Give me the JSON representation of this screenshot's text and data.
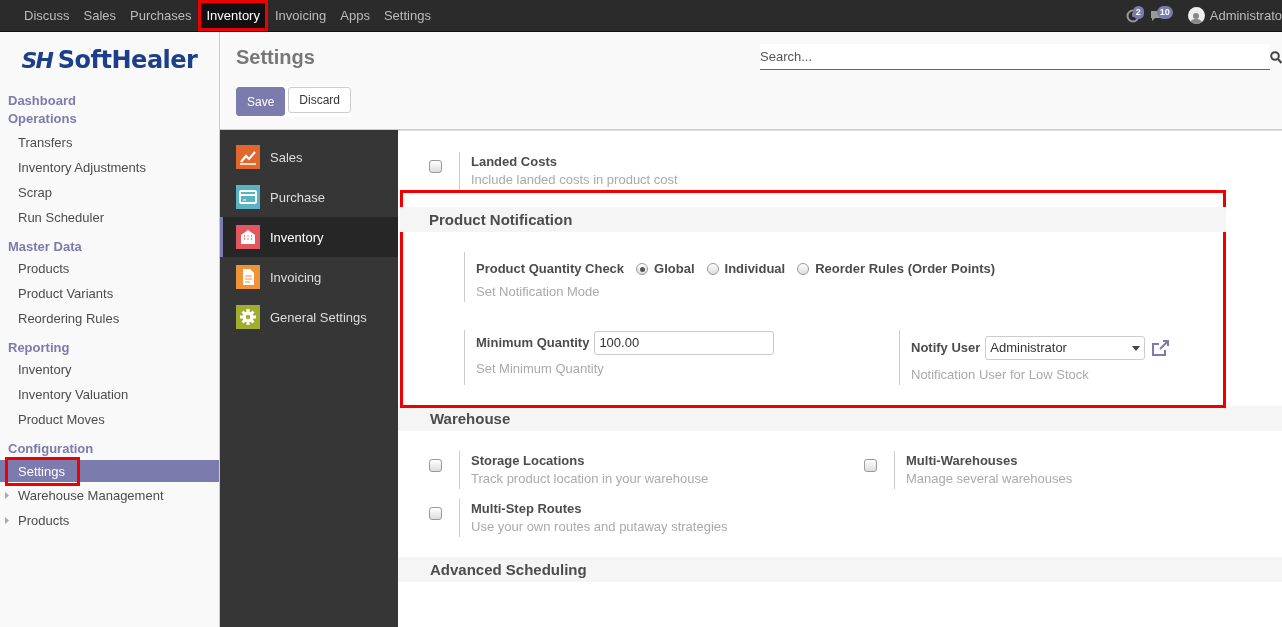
{
  "top_menu": [
    {
      "label": "Discuss",
      "selected": false,
      "highlighted": false
    },
    {
      "label": "Sales",
      "selected": false,
      "highlighted": false
    },
    {
      "label": "Purchases",
      "selected": false,
      "highlighted": false
    },
    {
      "label": "Inventory",
      "selected": true,
      "highlighted": true
    },
    {
      "label": "Invoicing",
      "selected": false,
      "highlighted": false
    },
    {
      "label": "Apps",
      "selected": false,
      "highlighted": false
    },
    {
      "label": "Settings",
      "selected": false,
      "highlighted": false
    }
  ],
  "systray": {
    "activity_count": "2",
    "message_count": "10",
    "user_name": "Administrato"
  },
  "logo": {
    "mark": "SH",
    "text": "SoftHealer"
  },
  "sidebar": {
    "sections": [
      {
        "title": "Dashboard"
      },
      {
        "title": "Operations",
        "items": [
          {
            "label": "Transfers",
            "kind": "link",
            "selected": false,
            "highlighted": false
          },
          {
            "label": "Inventory Adjustments",
            "kind": "link",
            "selected": false,
            "highlighted": false
          },
          {
            "label": "Scrap",
            "kind": "link",
            "selected": false,
            "highlighted": false
          },
          {
            "label": "Run Scheduler",
            "kind": "link",
            "selected": false,
            "highlighted": false
          }
        ]
      },
      {
        "title": "Master Data",
        "items": [
          {
            "label": "Products",
            "kind": "link",
            "selected": false,
            "highlighted": false
          },
          {
            "label": "Product Variants",
            "kind": "link",
            "selected": false,
            "highlighted": false
          },
          {
            "label": "Reordering Rules",
            "kind": "link",
            "selected": false,
            "highlighted": false
          }
        ]
      },
      {
        "title": "Reporting",
        "items": [
          {
            "label": "Inventory",
            "kind": "link",
            "selected": false,
            "highlighted": false
          },
          {
            "label": "Inventory Valuation",
            "kind": "link",
            "selected": false,
            "highlighted": false
          },
          {
            "label": "Product Moves",
            "kind": "link",
            "selected": false,
            "highlighted": false
          }
        ]
      },
      {
        "title": "Configuration",
        "items": [
          {
            "label": "Settings",
            "kind": "link",
            "selected": true,
            "highlighted": true
          },
          {
            "label": "Warehouse Management",
            "kind": "folder",
            "selected": false,
            "highlighted": false
          },
          {
            "label": "Products",
            "kind": "folder",
            "selected": false,
            "highlighted": false
          }
        ]
      }
    ]
  },
  "page_title": "Settings",
  "search": {
    "placeholder": "Search..."
  },
  "buttons": [
    {
      "label": "Save",
      "kind": "primary"
    },
    {
      "label": "Discard",
      "kind": "secondary"
    }
  ],
  "apps": [
    {
      "label": "Sales",
      "kind": "chart",
      "color": "#e0672e",
      "selected": false
    },
    {
      "label": "Purchase",
      "kind": "card",
      "color": "#5ab3c4",
      "selected": false
    },
    {
      "label": "Inventory",
      "kind": "building",
      "color": "#e2575f",
      "selected": true
    },
    {
      "label": "Invoicing",
      "kind": "document",
      "color": "#ef9339",
      "selected": false
    },
    {
      "label": "General Settings",
      "kind": "gear",
      "color": "#9fae2c",
      "selected": false
    }
  ],
  "settings": {
    "sections": [
      {
        "settings": [
          {
            "kind": "checkbox",
            "title": "Landed Costs",
            "help": "Include landed costs in product cost",
            "checked": false
          }
        ]
      },
      {
        "title": "Product Notification",
        "highlighted": true,
        "settings": [
          {
            "kind": "radio",
            "title": "Product Quantity Check",
            "help": "Set Notification Mode",
            "options": [
              {
                "label": "Global",
                "selected": true
              },
              {
                "label": "Individual",
                "selected": false
              },
              {
                "label": "Reorder Rules (Order Points)",
                "selected": false
              }
            ]
          },
          {
            "kind": "number",
            "title": "Minimum Quantity",
            "value": "100.00",
            "help": "Set Minimum Quantity"
          },
          {
            "kind": "select",
            "title": "Notify User",
            "value": "Administrator",
            "help": "Notification User for Low Stock"
          }
        ]
      },
      {
        "title": "Warehouse",
        "settings": [
          {
            "kind": "checkbox",
            "title": "Storage Locations",
            "help": "Track product location in your warehouse",
            "checked": false
          },
          {
            "kind": "checkbox",
            "title": "Multi-Warehouses",
            "help": "Manage several warehouses",
            "checked": false
          },
          {
            "kind": "checkbox",
            "title": "Multi-Step Routes",
            "help": "Use your own routes and putaway strategies",
            "checked": false
          }
        ]
      },
      {
        "title": "Advanced Scheduling"
      }
    ]
  }
}
